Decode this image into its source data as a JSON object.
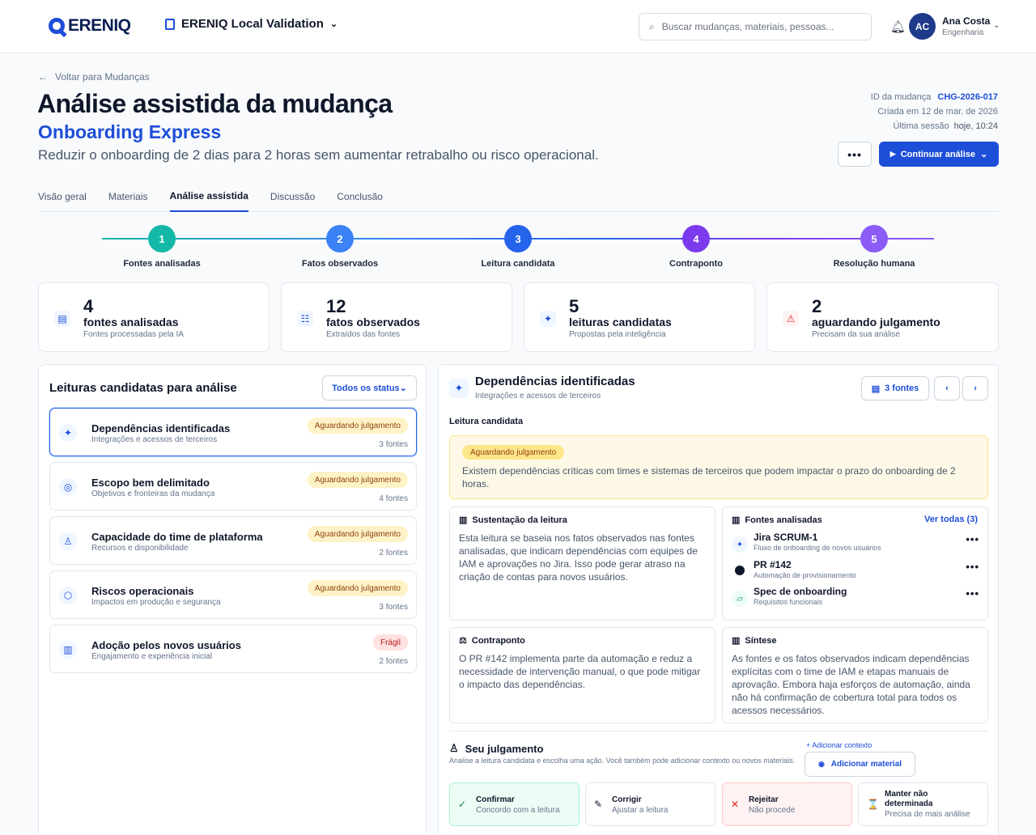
{
  "app": {
    "brand": "EREENIQ",
    "workspace": "ERENIQ Local Validation"
  },
  "search": {
    "placeholder": "Buscar mudanças, materiais, pessoas..."
  },
  "user": {
    "initials": "AC",
    "name": "Ana Costa",
    "role": "Engenharia"
  },
  "header": {
    "back_label": "Voltar para Mudanças",
    "title": "Análise assistida da mudança",
    "subtitle": "Onboarding Express",
    "description": "Reduzir o onboarding de 2 dias para 2 horas sem aumentar retrabalho ou risco operacional.",
    "meta": [
      {
        "label": "ID da mudança",
        "value": "CHG-2026-017"
      },
      {
        "label": "Criada em 12 de mar. de 2026",
        "value": ""
      },
      {
        "label": "Última sessão",
        "value": "hoje, 10:24"
      }
    ],
    "more_label": "•••",
    "continue_label": "Continuar análise"
  },
  "tabs": [
    "Visão geral",
    "Materiais",
    "Análise assistida",
    "Discussão",
    "Conclusão"
  ],
  "steps": [
    {
      "n": "1",
      "label": "Fontes analisadas",
      "color": "#14b8a6"
    },
    {
      "n": "2",
      "label": "Fatos observados",
      "color": "#3b82f6"
    },
    {
      "n": "3",
      "label": "Leitura candidata",
      "color": "#2563eb"
    },
    {
      "n": "4",
      "label": "Contraponto",
      "color": "#7c3aed"
    },
    {
      "n": "5",
      "label": "Resolução humana",
      "color": "#8b5cf6"
    }
  ],
  "kpis": [
    {
      "value": "4",
      "title": "fontes analisadas",
      "sub": "Fontes processadas pela IA",
      "icon": "document-icon"
    },
    {
      "value": "12",
      "title": "fatos observados",
      "sub": "Extraídos das fontes",
      "icon": "list-icon"
    },
    {
      "value": "5",
      "title": "leituras candidatas",
      "sub": "Propostas pela inteligência",
      "icon": "sparkle-icon"
    },
    {
      "value": "2",
      "title": "aguardando julgamento",
      "sub": "Precisam da sua análise",
      "icon": "warning-icon"
    }
  ],
  "left": {
    "title": "Leituras candidatas para análise",
    "filter": "Todos os status",
    "items": [
      {
        "title": "Dependências identificadas",
        "sub": "Integrações e acessos de terceiros",
        "status": "Aguardando julgamento",
        "sources": "3 fontes",
        "icon": "✦"
      },
      {
        "title": "Escopo bem delimitado",
        "sub": "Objetivos e fronteiras da mudança",
        "status": "Aguardando julgamento",
        "sources": "4 fontes",
        "icon": "◎"
      },
      {
        "title": "Capacidade do time de plataforma",
        "sub": "Recursos e disponibilidade",
        "status": "Aguardando julgamento",
        "sources": "2 fontes",
        "icon": "♙"
      },
      {
        "title": "Riscos operacionais",
        "sub": "Impactos em produção e segurança",
        "status": "Aguardando julgamento",
        "sources": "3 fontes",
        "icon": "⬡"
      },
      {
        "title": "Adoção pelos novos usuários",
        "sub": "Engajamento e experiência inicial",
        "status": "Frágil",
        "sources": "2 fontes",
        "icon": "▥"
      }
    ]
  },
  "detail": {
    "title": "Dependências identificadas",
    "sub": "Integrações e acessos de terceiros",
    "sources_btn": "3 fontes",
    "section_label": "Leitura candidata",
    "status": "Aguardando julgamento",
    "reading": "Existem dependências críticas com times e sistemas de terceiros que podem impactar o prazo do onboarding de 2 horas.",
    "support_title": "Sustentação da leitura",
    "support_text": "Esta leitura se baseia nos fatos observados nas fontes analisadas, que indicam dependências com equipes de IAM e aprovações no Jira. Isso pode gerar atraso na criação de contas para novos usuários.",
    "sources_title": "Fontes analisadas",
    "see_all": "Ver todas (3)",
    "sources": [
      {
        "title": "Jira SCRUM-1",
        "sub": "Fluxo de onboarding de novos usuários"
      },
      {
        "title": "PR #142",
        "sub": "Automação de provisionamento"
      },
      {
        "title": "Spec de onboarding",
        "sub": "Requisitos funcionais"
      }
    ],
    "counter_title": "Contraponto",
    "counter_text": "O PR #142 implementa parte da automação e reduz a necessidade de intervenção manual, o que pode mitigar o impacto das dependências.",
    "synthesis_title": "Síntese",
    "synthesis_text": "As fontes e os fatos observados indicam dependências explícitas com o time de IAM e etapas manuais de aprovação. Embora haja esforços de automação, ainda não há confirmação de cobertura total para todos os acessos necessários.",
    "judgment_title": "Seu julgamento",
    "judgment_sub": "Analise a leitura candidata e escolha uma ação. Você também pode adicionar contexto ou novos materiais.",
    "add_context": "+ Adicionar contexto",
    "add_material": "Adicionar material",
    "actions": [
      {
        "title": "Confirmar",
        "sub": "Concordo com a leitura",
        "icon": "✓",
        "bg": "#ecfdf5",
        "border": "#a7f3d0",
        "color": "#15803d"
      },
      {
        "title": "Corrigir",
        "sub": "Ajustar a leitura",
        "icon": "✎",
        "bg": "#ffffff",
        "border": "#e2e8f0",
        "color": "#0f172a"
      },
      {
        "title": "Rejeitar",
        "sub": "Não procede",
        "icon": "✕",
        "bg": "#fef2f2",
        "border": "#fecaca",
        "color": "#dc2626"
      },
      {
        "title": "Manter não determinada",
        "sub": "Precisa de mais análise",
        "icon": "⌛",
        "bg": "#ffffff",
        "border": "#e2e8f0",
        "color": "#b45309"
      }
    ]
  }
}
